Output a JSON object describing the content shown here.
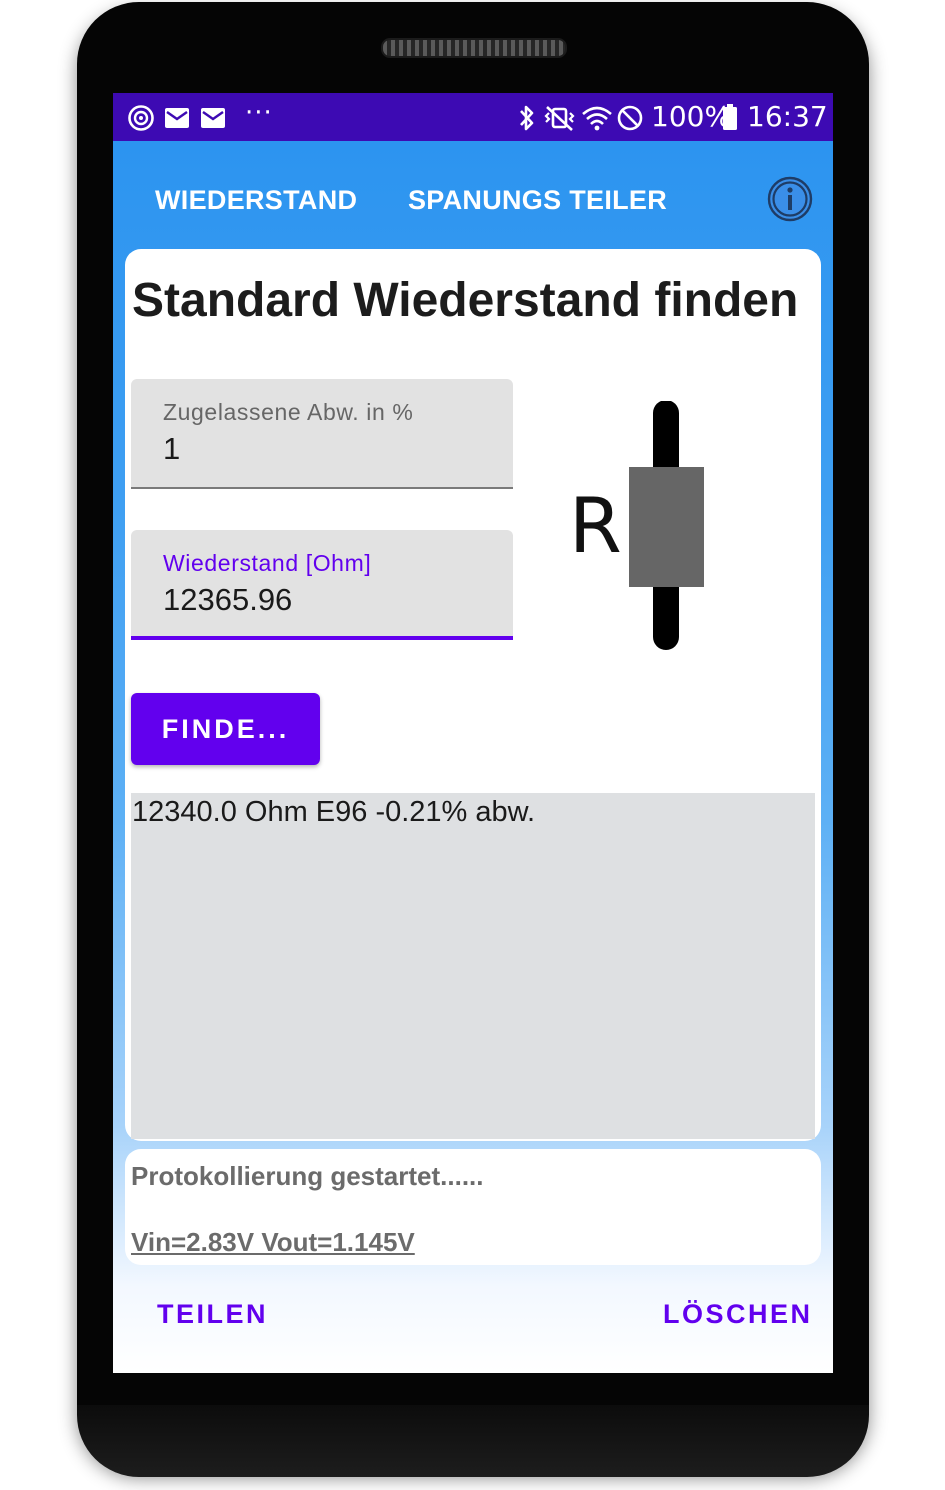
{
  "status_bar": {
    "battery": "100%",
    "time": "16:37",
    "more": "···",
    "icons_left": [
      "target-icon",
      "mail-icon",
      "mail-icon"
    ],
    "icons_right": [
      "bluetooth-icon",
      "vibrate-icon",
      "wifi-icon",
      "do-not-disturb-icon",
      "battery-icon"
    ]
  },
  "tabs": [
    "WIEDERSTAND",
    "SPANUNGS TEILER"
  ],
  "title": "Standard Wiederstand finden",
  "tolerance": {
    "label": "Zugelassene Abw. in %",
    "value": "1"
  },
  "resistance": {
    "label": "Wiederstand [Ohm]",
    "value": "12365.96"
  },
  "resistor_symbol_label": "R",
  "find_button": "FINDE...",
  "result_text": "12340.0 Ohm E96 -0.21% abw.",
  "log": {
    "line1": "Protokollierung gestartet......",
    "line2": "Vin=2.83V Vout=1.145V"
  },
  "share_button": "TEILEN",
  "clear_button": "LÖSCHEN",
  "colors": {
    "status_bar": "#3d0ab3",
    "accent": "#6200ee",
    "app_bar": "#2c94f0",
    "field_bg": "#e2e2e2",
    "result_bg": "#dee0e2"
  }
}
